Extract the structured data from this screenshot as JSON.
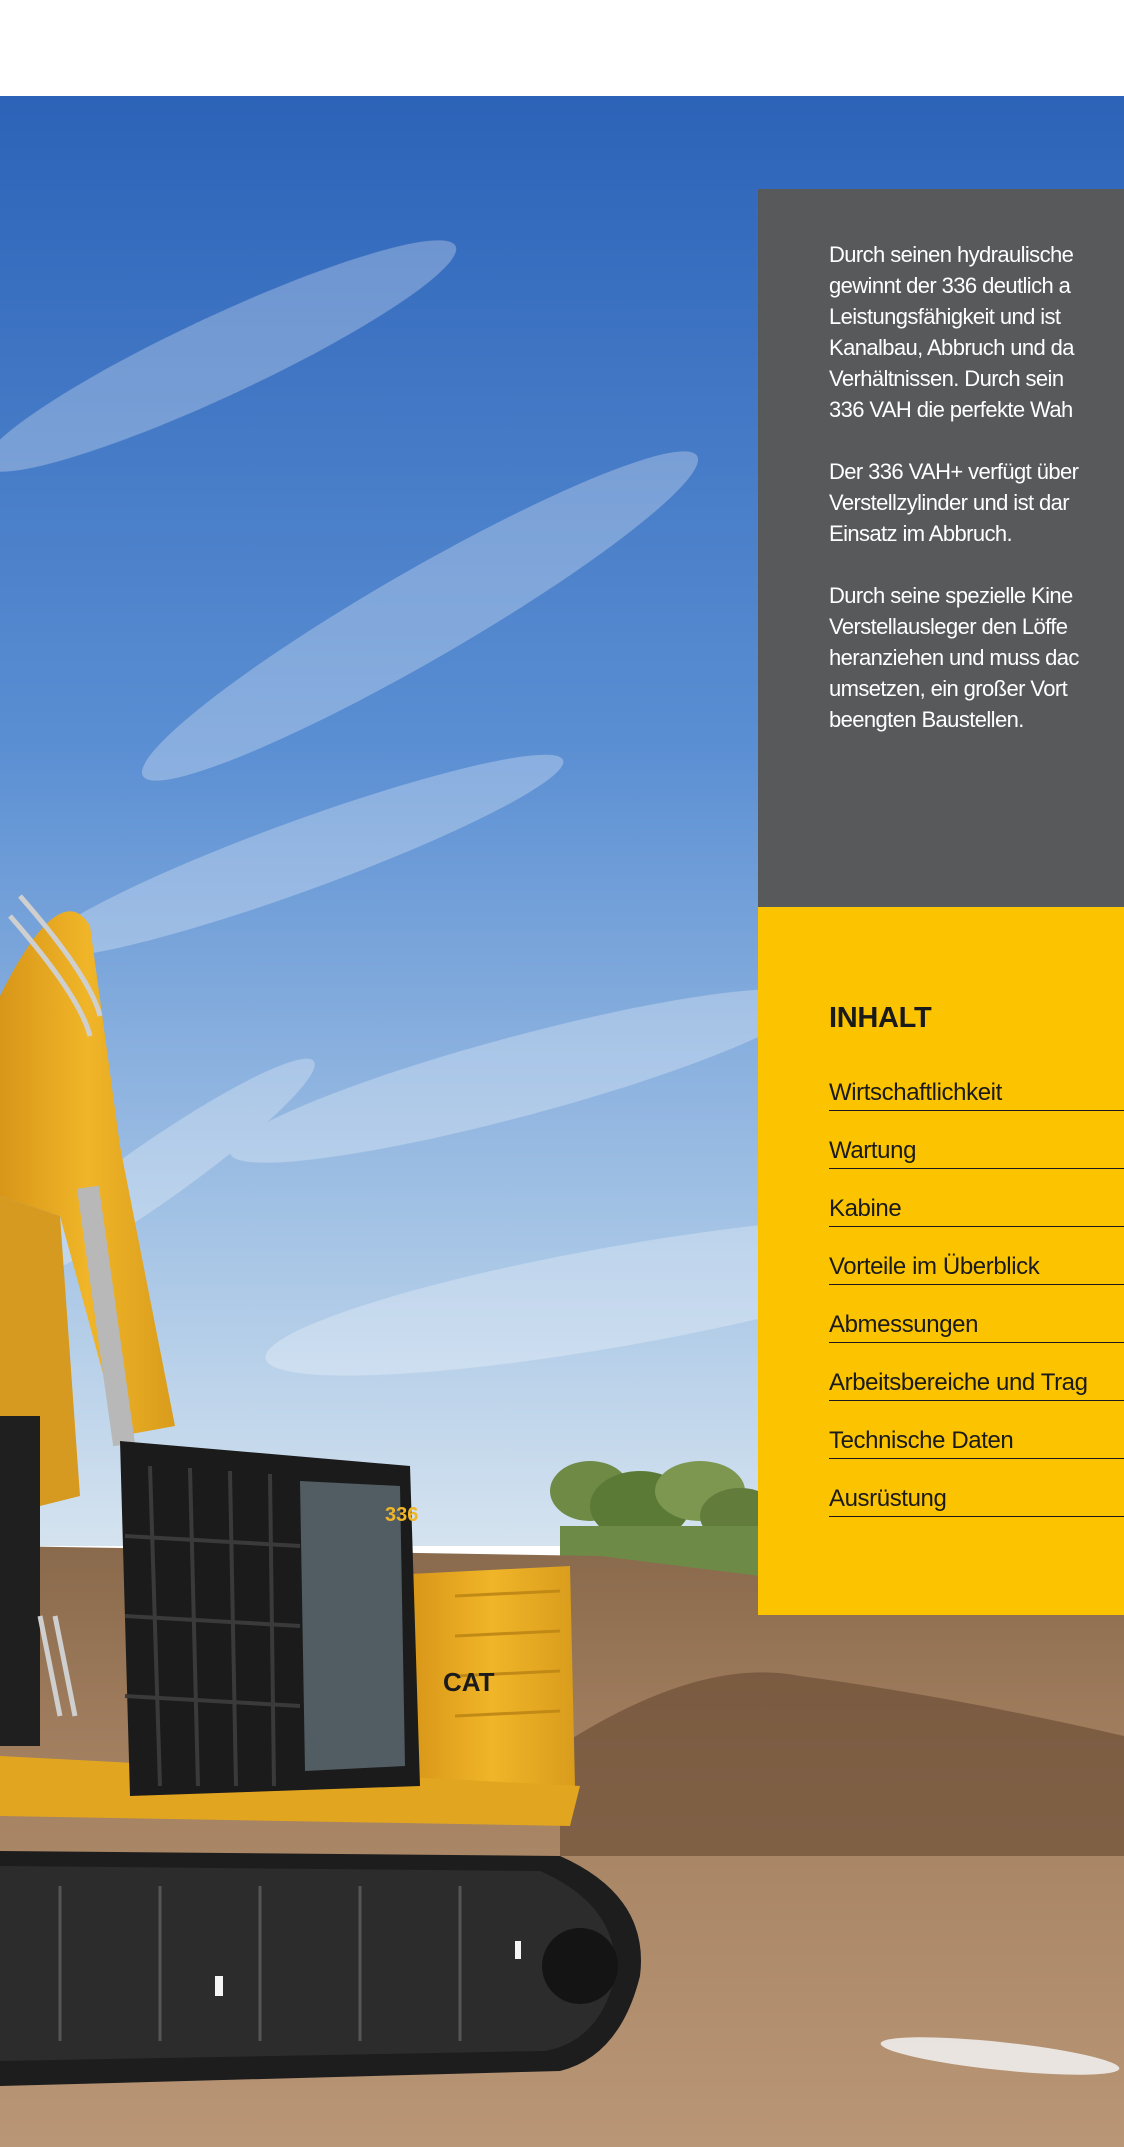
{
  "intro": {
    "paragraphs": [
      "Durch seinen hydraulische",
      "Der 336 VAH+ verfügt übe",
      "Durch seine spezielle Kine"
    ],
    "paragraph_lines": [
      [
        "Durch seinen hydraulische",
        "gewinnt der 336 deutlich a",
        "Leistungsfähigkeit und ist",
        "Kanalbau, Abbruch und da",
        "Verhältnissen. Durch sein",
        "336 VAH die perfekte Wah"
      ],
      [
        "Der 336 VAH+ verfügt über",
        "Verstellzylinder und ist dar",
        "Einsatz im Abbruch."
      ],
      [
        "Durch seine spezielle Kine",
        "Verstellausleger den Löffe",
        "heranziehen und muss dac",
        "umsetzen, ein großer Vort",
        "beengten Baustellen."
      ]
    ]
  },
  "toc": {
    "heading": "INHALT",
    "items": [
      "Wirtschaftlichkeit",
      "Wartung",
      "Kabine",
      "Vorteile im Überblick",
      "Abmessungen",
      "Arbeitsbereiche und Trag",
      "Technische Daten",
      "Ausrüstung"
    ]
  },
  "photo": {
    "subject": "excavator-photo",
    "badge": "336",
    "brand": "CAT"
  },
  "colors": {
    "grey_panel": "#58595b",
    "yellow_panel": "#fbc300",
    "machine_yellow": "#e9a91a",
    "sky": "#3f78c8"
  }
}
